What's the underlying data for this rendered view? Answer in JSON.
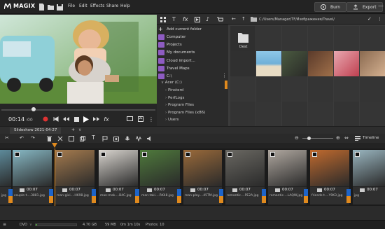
{
  "app": {
    "brand": "MAGIX"
  },
  "menu": [
    "File",
    "Edit",
    "Effects",
    "Share",
    "Help"
  ],
  "header_buttons": {
    "burn": "Burn",
    "export": "Export"
  },
  "player": {
    "timecode": "00:14",
    "timecode_frames": "00"
  },
  "media_pool": {
    "quick_access": [
      {
        "label": "Add current folder",
        "icon": "plus-icon",
        "color": "#dddddd"
      },
      {
        "label": "Computer",
        "icon": "computer-icon",
        "color": "#8e5cc2"
      },
      {
        "label": "Projects",
        "icon": "projects-icon",
        "color": "#8e5cc2"
      },
      {
        "label": "My documents",
        "icon": "documents-icon",
        "color": "#8e5cc2"
      },
      {
        "label": "Cloud import...",
        "icon": "cloud-icon",
        "color": "#8e5cc2"
      },
      {
        "label": "Travel Maps",
        "icon": "map-icon",
        "color": "#8e5cc2"
      },
      {
        "label": "C:\\",
        "icon": "drive-icon",
        "color": "#8e5cc2"
      }
    ],
    "tree": {
      "root": "Acer (C:)",
      "children": [
        "Pinsterd",
        "PerfLogs",
        "Program Files",
        "Program Files (x86)",
        "Users"
      ]
    },
    "path": "C:/Users/Manager/TF/Изображения/Travel/",
    "folder_label": "Dest"
  },
  "timeline": {
    "project_tab": "Slideshow 2021-04-27",
    "view_label": "Timeline",
    "clips": [
      {
        "name": "jpg",
        "duration": "",
        "color": "#5d8a9a"
      },
      {
        "name": "couple-t....3881.jpg",
        "duration": "00:07",
        "color": "#87b8c4"
      },
      {
        "name": "man-givi....H698.jpg",
        "duration": "00:07",
        "color": "#a57b4e"
      },
      {
        "name": "man-mak....B4C.jpg",
        "duration": "00:07",
        "color": "#d9d5cf"
      },
      {
        "name": "man-taki....RK48.jpg",
        "duration": "00:07",
        "color": "#4f7a3c"
      },
      {
        "name": "man-play....45TM.jpg",
        "duration": "00:07",
        "color": "#9a6a3a"
      },
      {
        "name": "romantic....PE2A.jpg",
        "duration": "00:07",
        "color": "#6a6862"
      },
      {
        "name": "romantic....LAQW.jpg",
        "duration": "00:07",
        "color": "#b0a8a0"
      },
      {
        "name": "friends-t....Y9K3.jpg",
        "duration": "00:07",
        "color": "#c06a2e"
      },
      {
        "name": "jpg",
        "duration": "00:07",
        "color": "#9ab6c0"
      }
    ]
  },
  "status": {
    "disc": "DVD",
    "size": "4.70 GB",
    "used": "59 MB",
    "duration": "0m 1m 10s",
    "photos": "Photos: 10"
  }
}
